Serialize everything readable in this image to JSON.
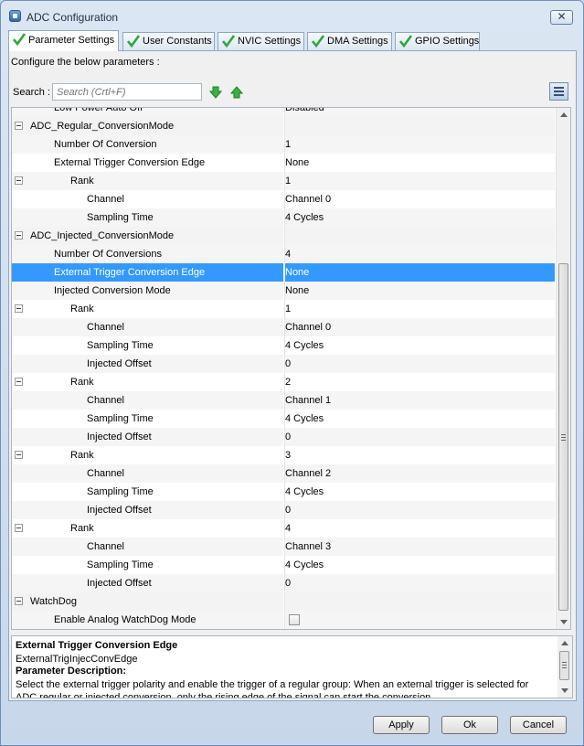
{
  "window": {
    "title": "ADC Configuration",
    "close_glyph": "✕"
  },
  "tabs": [
    {
      "label": "Parameter Settings",
      "active": true
    },
    {
      "label": "User Constants"
    },
    {
      "label": "NVIC Settings"
    },
    {
      "label": "DMA Settings"
    },
    {
      "label": "GPIO Settings"
    }
  ],
  "hint": "Configure the below parameters :",
  "search": {
    "label": "Search :",
    "placeholder": "Search (Crtl+F)"
  },
  "rows": [
    {
      "name": "Low Power Auto Off",
      "value": "Disabled",
      "indent": 46
    },
    {
      "name": "ADC_Regular_ConversionMode",
      "value": "",
      "indent": 20,
      "toggle": true,
      "group": true
    },
    {
      "name": "Number Of Conversion",
      "value": "1",
      "indent": 46
    },
    {
      "name": "External Trigger Conversion Edge",
      "value": "None",
      "indent": 46
    },
    {
      "name": "Rank",
      "value": "1",
      "indent": 64,
      "toggle": true
    },
    {
      "name": "Channel",
      "value": "Channel 0",
      "indent": 82
    },
    {
      "name": "Sampling Time",
      "value": "4 Cycles",
      "indent": 82
    },
    {
      "name": "ADC_Injected_ConversionMode",
      "value": "",
      "indent": 20,
      "toggle": true,
      "group": true
    },
    {
      "name": "Number Of Conversions",
      "value": "4",
      "indent": 46
    },
    {
      "name": "External Trigger Conversion Edge",
      "value": "None",
      "indent": 46,
      "selected": true
    },
    {
      "name": "Injected Conversion Mode",
      "value": "None",
      "indent": 46
    },
    {
      "name": "Rank",
      "value": "1",
      "indent": 64,
      "toggle": true
    },
    {
      "name": "Channel",
      "value": "Channel 0",
      "indent": 82
    },
    {
      "name": "Sampling Time",
      "value": "4 Cycles",
      "indent": 82
    },
    {
      "name": "Injected Offset",
      "value": "0",
      "indent": 82
    },
    {
      "name": "Rank",
      "value": "2",
      "indent": 64,
      "toggle": true
    },
    {
      "name": "Channel",
      "value": "Channel 1",
      "indent": 82
    },
    {
      "name": "Sampling Time",
      "value": "4 Cycles",
      "indent": 82
    },
    {
      "name": "Injected Offset",
      "value": "0",
      "indent": 82
    },
    {
      "name": "Rank",
      "value": "3",
      "indent": 64,
      "toggle": true
    },
    {
      "name": "Channel",
      "value": "Channel 2",
      "indent": 82
    },
    {
      "name": "Sampling Time",
      "value": "4 Cycles",
      "indent": 82
    },
    {
      "name": "Injected Offset",
      "value": "0",
      "indent": 82
    },
    {
      "name": "Rank",
      "value": "4",
      "indent": 64,
      "toggle": true
    },
    {
      "name": "Channel",
      "value": "Channel 3",
      "indent": 82
    },
    {
      "name": "Sampling Time",
      "value": "4 Cycles",
      "indent": 82
    },
    {
      "name": "Injected Offset",
      "value": "0",
      "indent": 82
    },
    {
      "name": "WatchDog",
      "value": "",
      "indent": 20,
      "toggle": true,
      "group": true
    },
    {
      "name": "Enable Analog WatchDog Mode",
      "value": "",
      "indent": 46,
      "checkbox": true
    }
  ],
  "description": {
    "title": "External Trigger Conversion Edge",
    "param": "ExternalTrigInjecConvEdge",
    "heading": "Parameter Description:",
    "text": "Select the external trigger polarity and enable the trigger of a regular group: When an external trigger is selected for ADC regular or injected conversion, only the rising edge of the signal can start the conversion."
  },
  "buttons": {
    "apply": "Apply",
    "ok": "Ok",
    "cancel": "Cancel"
  },
  "colors": {
    "selection": "#3399ff",
    "check": "#2fa83a",
    "arrow": "#2fa83a"
  }
}
